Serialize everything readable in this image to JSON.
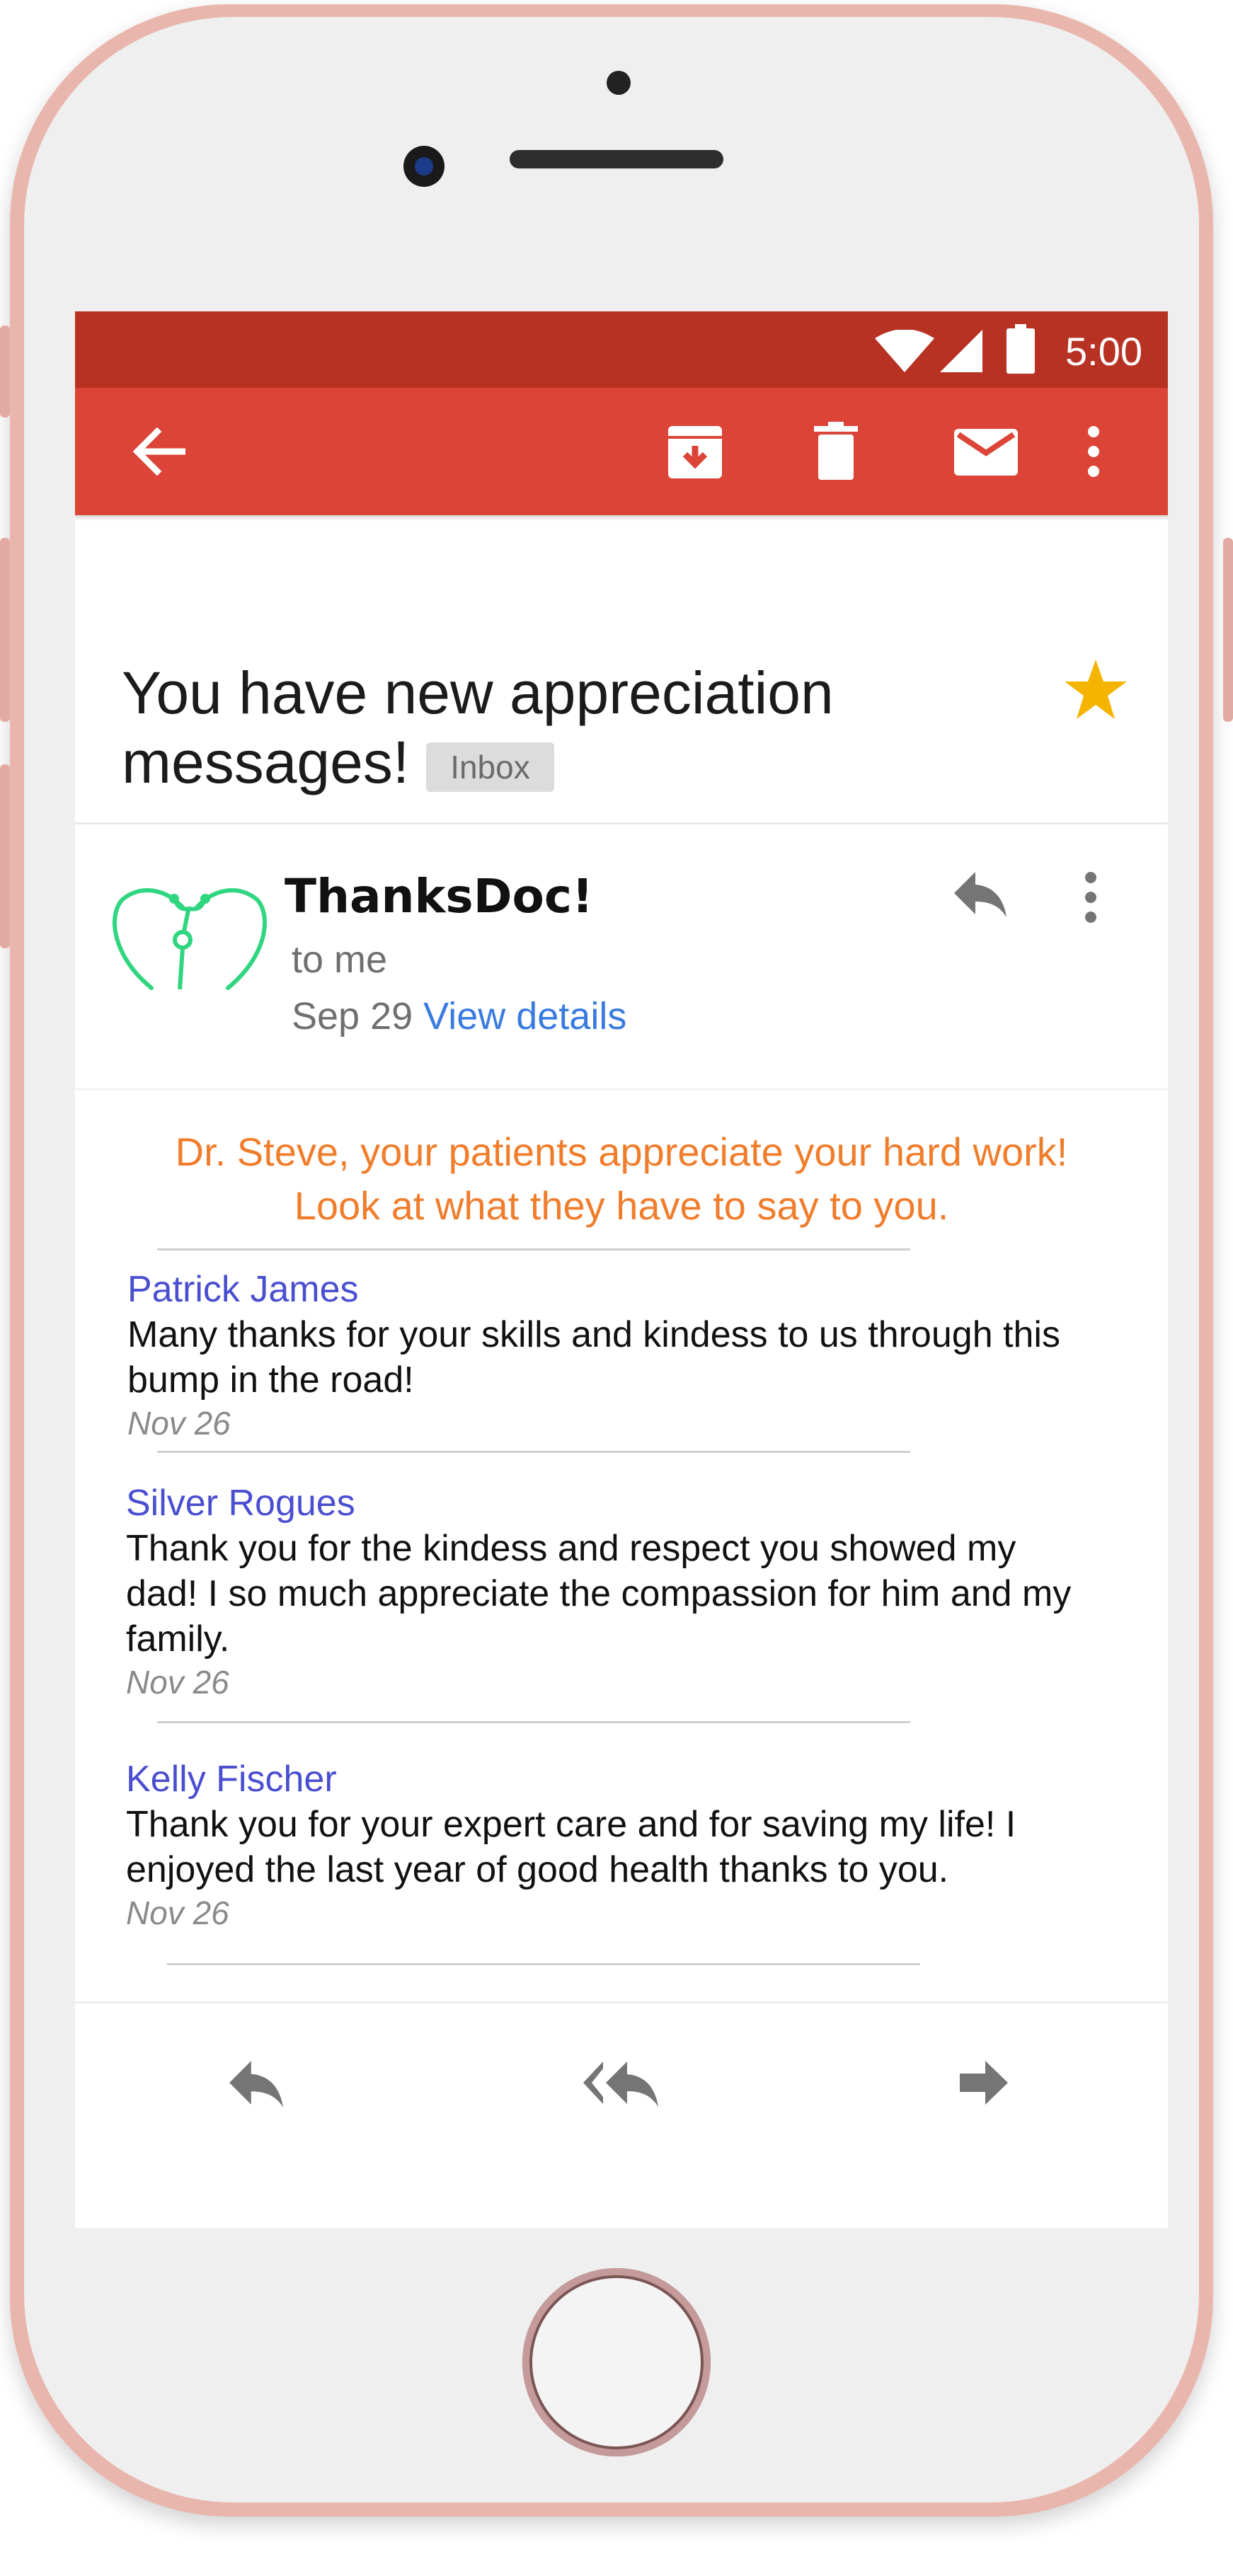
{
  "status_bar": {
    "time": "5:00"
  },
  "toolbar": {
    "back_icon": "arrow-left-icon",
    "archive_icon": "archive-icon",
    "delete_icon": "trash-icon",
    "mark_unread_icon": "mail-icon",
    "more_icon": "more-vert-icon"
  },
  "email": {
    "subject": "You have new appreciation messages!",
    "label": "Inbox",
    "starred": true,
    "sender": {
      "name": "ThanksDoc!",
      "recipient": "to me",
      "date": "Sep 29",
      "details_link": "View details"
    },
    "headline_line1": "Dr. Steve, your patients appreciate your hard work!",
    "headline_line2": "Look at what they have to say to you.",
    "messages": [
      {
        "author": "Patrick James",
        "lines": [
          "Many thanks for your skills and kindess to us through this",
          "bump in the road!"
        ],
        "date": "Nov 26"
      },
      {
        "author": "Silver Rogues",
        "lines": [
          "Thank you for the kindess and respect you showed my",
          "dad! I so much appreciate the compassion for him and my",
          "family."
        ],
        "date": "Nov 26"
      },
      {
        "author": "Kelly Fischer",
        "lines": [
          "Thank you for your expert care and for saving my life! I",
          "enjoyed the last year of good health thanks to you."
        ],
        "date": "Nov 26"
      }
    ]
  },
  "bottom_actions": {
    "reply_icon": "reply-icon",
    "reply_all_icon": "reply-all-icon",
    "forward_icon": "forward-icon"
  },
  "colors": {
    "status_bar": "#b73223",
    "toolbar": "#db4437",
    "star": "#f4b400",
    "headline": "#f07d2c",
    "author": "#4a4ed0",
    "link": "#3a7be0",
    "logo": "#2fd67f"
  }
}
